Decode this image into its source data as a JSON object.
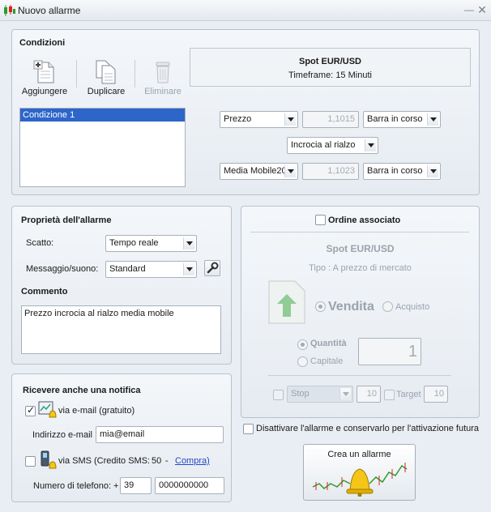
{
  "window": {
    "title": "Nuovo allarme",
    "minimize_icon": "minimize-icon",
    "close_icon": "close-icon"
  },
  "conditions": {
    "title": "Condizioni",
    "toolbar": {
      "add": "Aggiungere",
      "duplicate": "Duplicare",
      "delete": "Eliminare"
    },
    "list": [
      "Condizione 1"
    ],
    "instrument": {
      "symbol": "Spot EUR/USD",
      "timeframe_label": "Timeframe:",
      "timeframe_value": "15 Minuti"
    },
    "row1": {
      "source": "Prezzo",
      "value": "1,1015",
      "bar": "Barra in corso"
    },
    "operator": "Incrocia al rialzo",
    "row2": {
      "source": "Media Mobile20",
      "value": "1,1023",
      "bar": "Barra in corso"
    }
  },
  "properties": {
    "title": "Proprietà dell'allarme",
    "trigger_label": "Scatto:",
    "trigger_value": "Tempo reale",
    "sound_label": "Messaggio/suono:",
    "sound_value": "Standard",
    "comment_title": "Commento",
    "comment_text": "Prezzo incrocia al rialzo media mobile"
  },
  "notify": {
    "title": "Ricevere anche una notifica",
    "email_label": "via e-mail (gratuito)",
    "email_addr_label": "Indirizzo e-mail",
    "email_addr_value": "mia@email",
    "sms_label": "via SMS (Credito SMS:",
    "sms_credit": "50",
    "sms_dash": "-",
    "sms_buy": "Compra)",
    "phone_label": "Numero di telefono: +",
    "phone_prefix": "39",
    "phone_number": "0000000000"
  },
  "order": {
    "title": "Ordine associato",
    "symbol": "Spot EUR/USD",
    "type_text": "Tipo : A prezzo di mercato",
    "sell": "Vendita",
    "buy": "Acquisto",
    "quantity_label": "Quantità",
    "capital_label": "Capitale",
    "quantity_value": "1",
    "stop_select": "Stop",
    "stop_value": "10",
    "target_label": "Target",
    "target_value": "10"
  },
  "disable_label": "Disattivare l'allarme e conservarlo per l'attivazione futura",
  "create_button": "Crea un allarme"
}
